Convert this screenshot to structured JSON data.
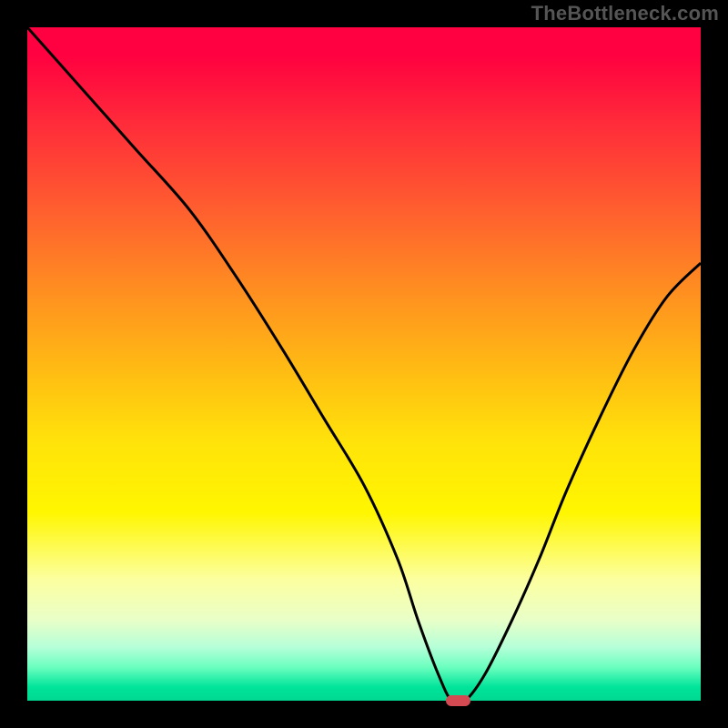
{
  "watermark": "TheBottleneck.com",
  "chart_data": {
    "type": "line",
    "title": "",
    "xlabel": "",
    "ylabel": "",
    "xlim": [
      0,
      100
    ],
    "ylim": [
      0,
      100
    ],
    "grid": false,
    "legend": false,
    "series": [
      {
        "name": "bottleneck-curve",
        "x": [
          0,
          8,
          16,
          24,
          31,
          38,
          44,
          50,
          55,
          58,
          61,
          63,
          65,
          68,
          72,
          76,
          80,
          85,
          90,
          95,
          100
        ],
        "y": [
          100,
          91,
          82,
          73,
          63,
          52,
          42,
          32,
          21,
          12,
          4,
          0,
          0,
          4,
          12,
          21,
          31,
          42,
          52,
          60,
          65
        ]
      }
    ],
    "marker": {
      "x": 64,
      "y": 0,
      "width_pct": 3.6
    },
    "background_gradient": {
      "stops": [
        {
          "pct": 0,
          "color": "#ff0040"
        },
        {
          "pct": 50,
          "color": "#ffb814"
        },
        {
          "pct": 72,
          "color": "#fff600"
        },
        {
          "pct": 100,
          "color": "#00d890"
        }
      ]
    }
  }
}
